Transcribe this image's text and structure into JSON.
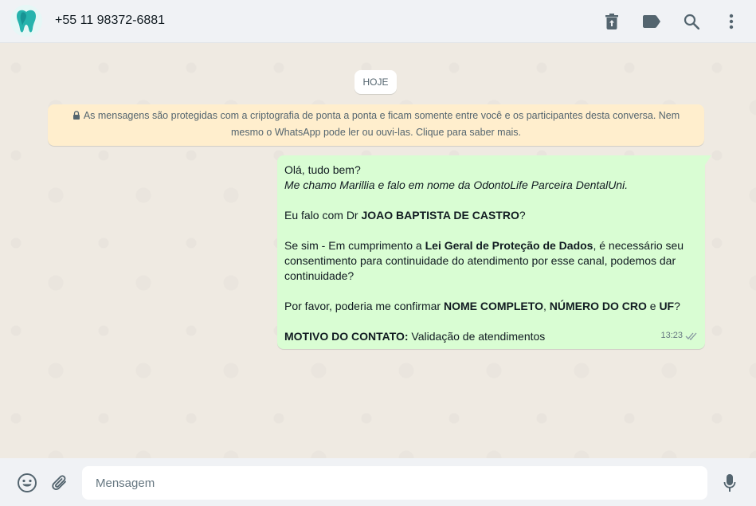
{
  "header": {
    "contact_name": "+55 11 98372-6881",
    "icons": [
      "delete-icon",
      "label-icon",
      "search-icon",
      "menu-icon"
    ]
  },
  "chat": {
    "date_chip": "HOJE",
    "encryption_notice": "As mensagens são protegidas com a criptografia de ponta a ponta e ficam somente entre você e os participantes desta conversa. Nem mesmo o WhatsApp pode ler ou ouvi-las. Clique para saber mais.",
    "message": {
      "line1": "Olá, tudo bem?",
      "line2": "Me chamo Marillia e falo em nome da OdontoLife Parceira DentalUni.",
      "p2_pre": "Eu falo com Dr ",
      "p2_bold": "JOAO BAPTISTA DE CASTRO",
      "p2_post": "?",
      "p3_pre": "Se sim - Em cumprimento a ",
      "p3_bold": "Lei Geral de Proteção de Dados",
      "p3_post": ", é necessário seu consentimento para continuidade do atendimento por esse canal, podemos dar continuidade?",
      "p4_pre": "Por favor, poderia me confirmar ",
      "p4_b1": "NOME COMPLETO",
      "p4_sep1": ", ",
      "p4_b2": "NÚMERO DO CRO",
      "p4_sep2": " e ",
      "p4_b3": "UF",
      "p4_post": "?",
      "p5_bold": "MOTIVO DO CONTATO:",
      "p5_post": " Validação de atendimentos",
      "time": "13:23",
      "status": "read"
    }
  },
  "footer": {
    "placeholder": "Mensagem",
    "value": ""
  },
  "colors": {
    "bubble_outgoing": "#d9fdd3",
    "encryption_bg": "#ffeecd",
    "chat_bg": "#efeae2",
    "read_ticks": "#8696a0"
  }
}
